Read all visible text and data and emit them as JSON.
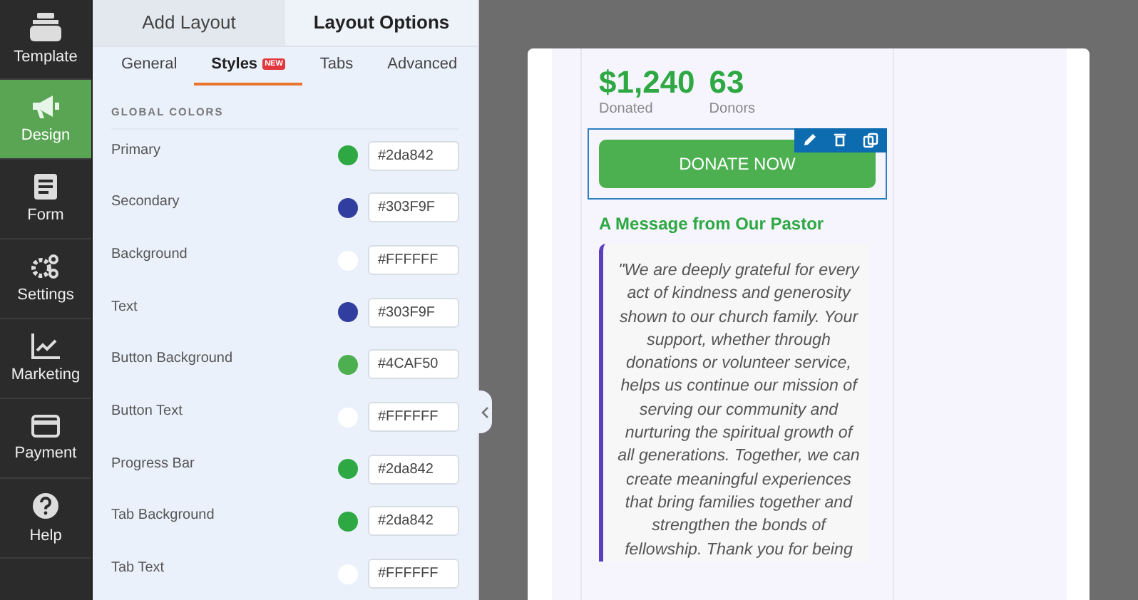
{
  "sidebar": {
    "items": [
      {
        "label": "Template",
        "kind": "template",
        "selected": false
      },
      {
        "label": "Design",
        "kind": "design",
        "selected": true
      },
      {
        "label": "Form",
        "kind": "form",
        "selected": false
      },
      {
        "label": "Settings",
        "kind": "settings",
        "selected": false
      },
      {
        "label": "Marketing",
        "kind": "marketing",
        "selected": false
      },
      {
        "label": "Payment",
        "kind": "payment",
        "selected": false
      },
      {
        "label": "Help",
        "kind": "help",
        "selected": false
      }
    ]
  },
  "panel": {
    "tabs": [
      {
        "label": "Add Layout",
        "selected": false
      },
      {
        "label": "Layout Options",
        "selected": true
      }
    ],
    "subtabs": [
      {
        "label": "General",
        "selected": false
      },
      {
        "label": "Styles",
        "badge": "NEW",
        "selected": true
      },
      {
        "label": "Tabs",
        "selected": false
      },
      {
        "label": "Advanced",
        "selected": false
      }
    ],
    "section_title": "GLOBAL COLORS",
    "colors": [
      {
        "label": "Primary",
        "color": "#2da842",
        "value": "#2da842"
      },
      {
        "label": "Secondary",
        "color": "#303f9f",
        "value": "#303F9F"
      },
      {
        "label": "Background",
        "color": "#ffffff",
        "value": "#FFFFFF"
      },
      {
        "label": "Text",
        "color": "#303f9f",
        "value": "#303F9F"
      },
      {
        "label": "Button Background",
        "color": "#4caf50",
        "value": "#4CAF50"
      },
      {
        "label": "Button Text",
        "color": "#ffffff",
        "value": "#FFFFFF"
      },
      {
        "label": "Progress Bar",
        "color": "#2da842",
        "value": "#2da842"
      },
      {
        "label": "Tab Background",
        "color": "#2da842",
        "value": "#2da842"
      },
      {
        "label": "Tab Text",
        "color": "#ffffff",
        "value": "#FFFFFF"
      }
    ]
  },
  "preview": {
    "stats": [
      {
        "value": "$1,240",
        "label": "Donated"
      },
      {
        "value": "63",
        "label": "Donors"
      }
    ],
    "donate_button": "DONATE NOW",
    "heading": "A Message from Our Pastor",
    "quote": "\"We are deeply grateful for every act of kindness and generosity shown to our church family. Your support, whether through donations or volunteer service, helps us continue our mission of serving our community and nurturing the spiritual growth of all generations. Together, we can create meaningful experiences that bring families together and strengthen the bonds of fellowship. Thank you for being"
  }
}
